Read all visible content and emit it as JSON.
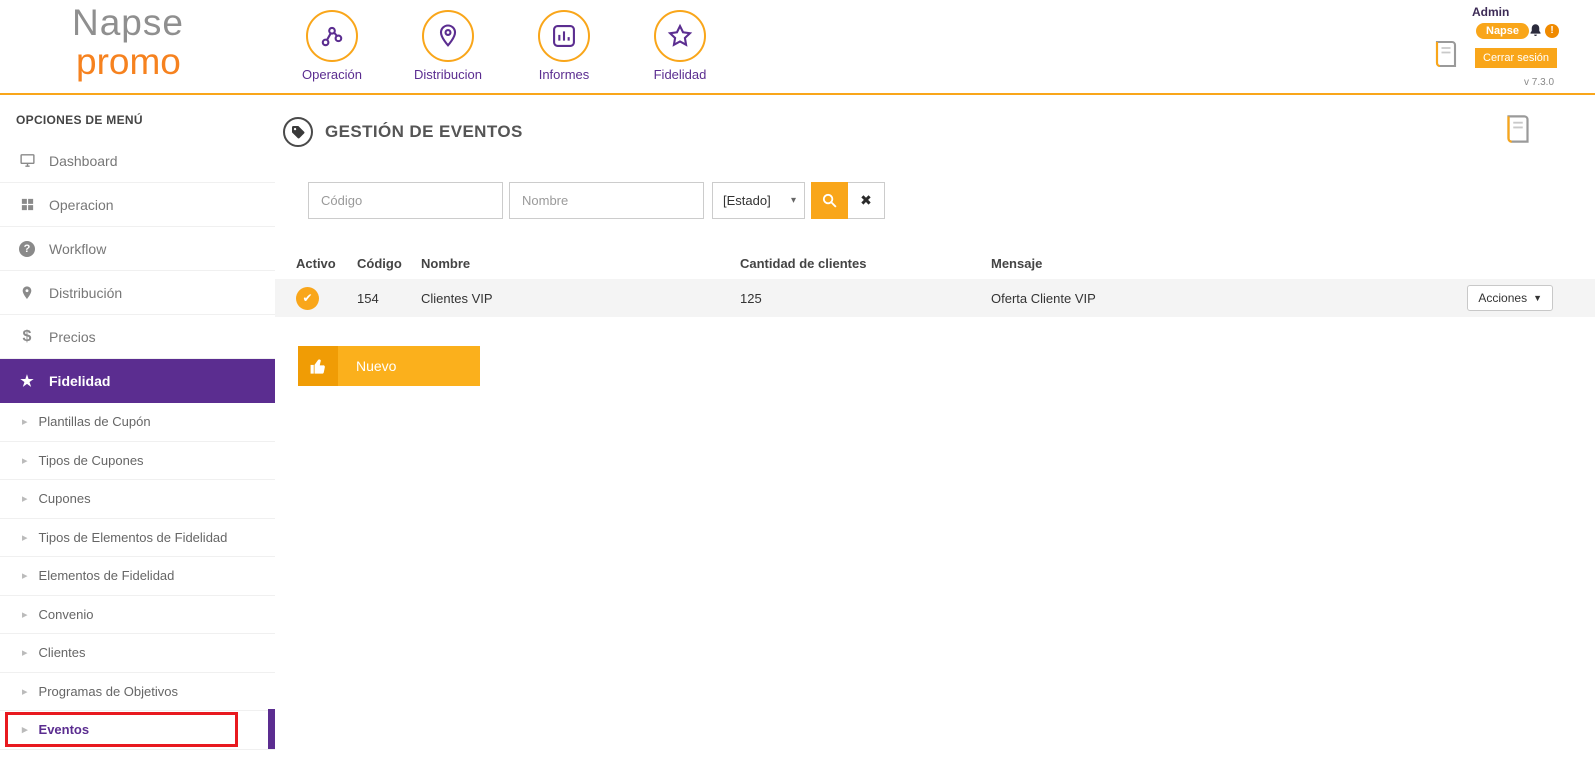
{
  "brand": {
    "line1": "Napse",
    "line2": "promo"
  },
  "top_nav": {
    "items": [
      {
        "label": "Operación",
        "icon": "nodes-icon"
      },
      {
        "label": "Distribucion",
        "icon": "location-pin-icon"
      },
      {
        "label": "Informes",
        "icon": "bar-chart-icon"
      },
      {
        "label": "Fidelidad",
        "icon": "star-icon"
      }
    ]
  },
  "user": {
    "name": "Admin",
    "badge": "Napse",
    "alert": "!",
    "logout_label": "Cerrar sesión",
    "version": "v 7.3.0"
  },
  "sidebar": {
    "title": "OPCIONES DE MENÚ",
    "items": [
      {
        "label": "Dashboard",
        "icon": "monitor-icon"
      },
      {
        "label": "Operacion",
        "icon": "grid-icon"
      },
      {
        "label": "Workflow",
        "icon": "question-circle-icon"
      },
      {
        "label": "Distribución",
        "icon": "location-pin-icon"
      },
      {
        "label": "Precios",
        "icon": "dollar-icon"
      },
      {
        "label": "Fidelidad",
        "icon": "star-icon",
        "active": true
      }
    ],
    "subitems": [
      {
        "label": "Plantillas de Cupón"
      },
      {
        "label": "Tipos de Cupones"
      },
      {
        "label": "Cupones"
      },
      {
        "label": "Tipos de Elementos de Fidelidad"
      },
      {
        "label": "Elementos de Fidelidad"
      },
      {
        "label": "Convenio"
      },
      {
        "label": "Clientes"
      },
      {
        "label": "Programas de Objetivos"
      },
      {
        "label": "Eventos",
        "highlighted": true
      }
    ]
  },
  "main": {
    "title": "GESTIÓN DE EVENTOS",
    "filters": {
      "codigo_placeholder": "Código",
      "nombre_placeholder": "Nombre",
      "estado_value": "[Estado]"
    },
    "table": {
      "headers": [
        "Activo",
        "Código",
        "Nombre",
        "Cantidad de clientes",
        "Mensaje"
      ],
      "rows": [
        {
          "activo": "✔",
          "codigo": "154",
          "nombre": "Clientes VIP",
          "cantidad_de_clientes": "125",
          "mensaje": "Oferta Cliente VIP",
          "acciones_label": "Acciones"
        }
      ]
    },
    "nuevo_label": "Nuevo"
  },
  "colors": {
    "accent_orange": "#f9a61a",
    "brand_purple": "#5b2d90",
    "promo_orange": "#f6821f",
    "annotation_red": "#e8191f",
    "row_background": "#f4f4f4"
  }
}
